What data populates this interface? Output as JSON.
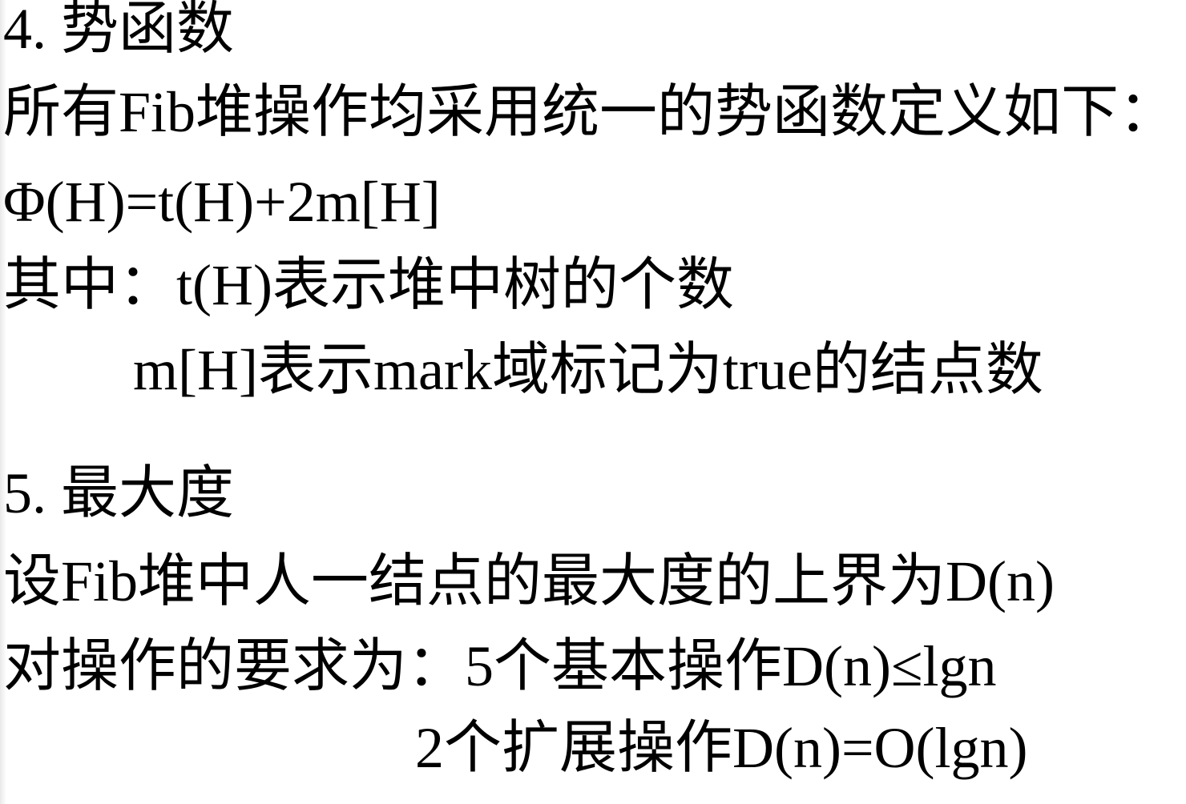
{
  "section_potential": {
    "heading": "4. 势函数",
    "intro": "所有Fib堆操作均采用统一的势函数定义如下：",
    "formula": "Φ(H)=t(H)+2m[H]",
    "where_line": "其中：t(H)表示堆中树的个数",
    "where_line_2": "m[H]表示mark域标记为true的结点数"
  },
  "section_max_degree": {
    "heading": "5. 最大度",
    "intro": "设Fib堆中人一结点的最大度的上界为D(n)",
    "requirement_line": "对操作的要求为：5个基本操作D(n)≤lgn",
    "requirement_line_2": "2个扩展操作D(n)=O(lgn)"
  }
}
